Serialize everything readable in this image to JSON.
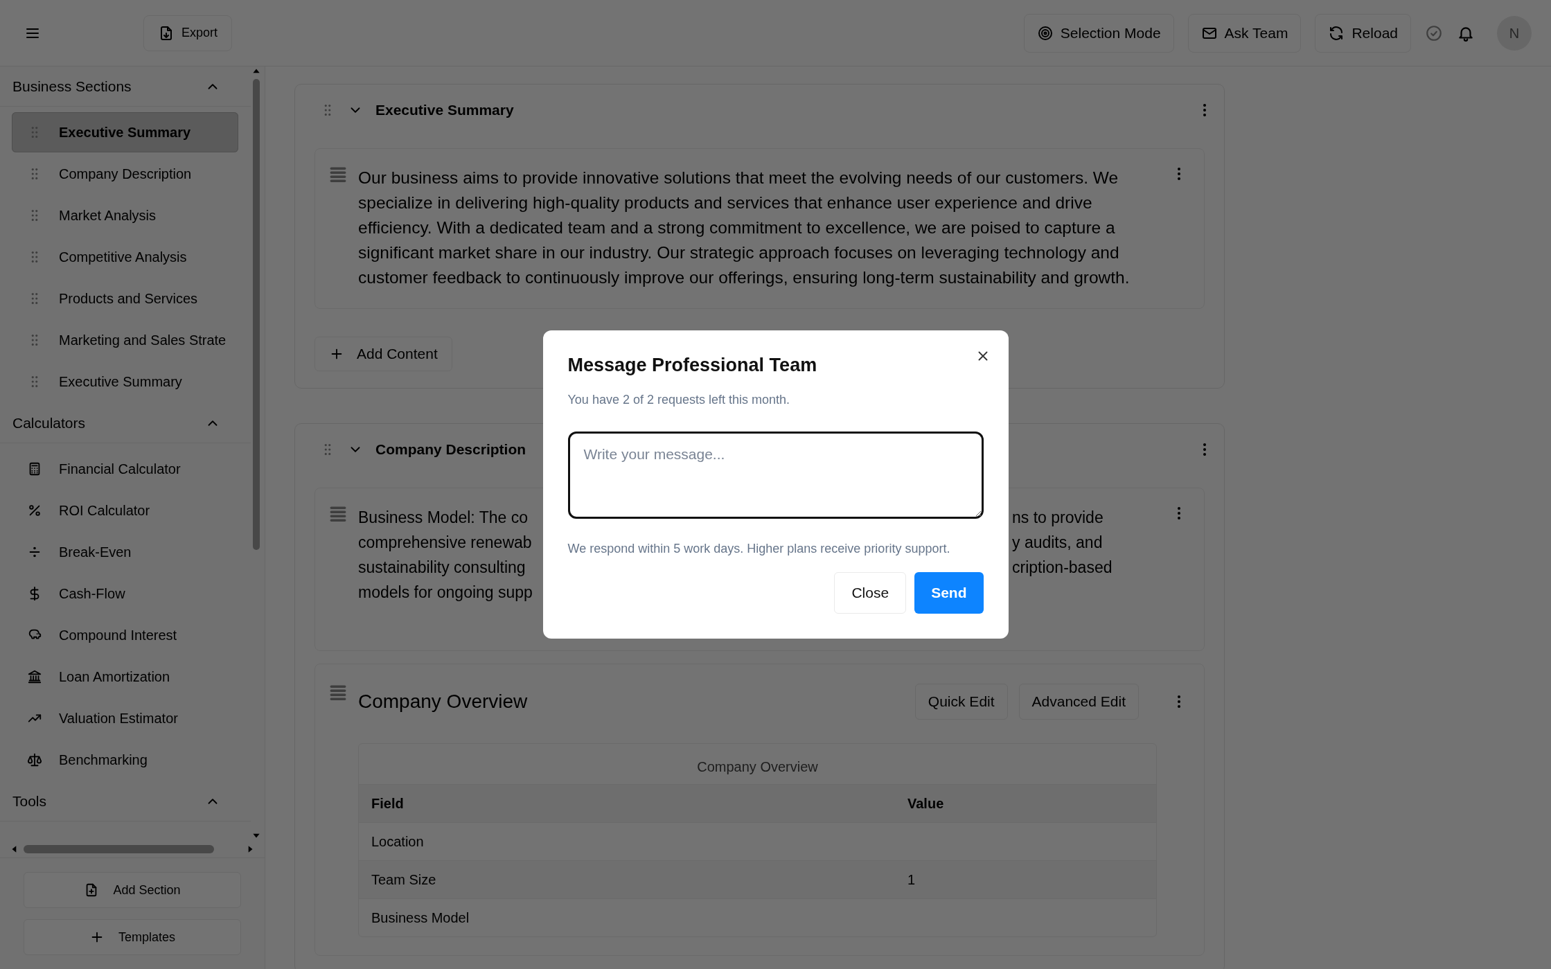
{
  "topbar": {
    "export_label": "Export",
    "actions": [
      {
        "label": "Selection Mode",
        "kind": "target"
      },
      {
        "label": "Ask Team",
        "kind": "mail"
      },
      {
        "label": "Reload",
        "kind": "reload"
      }
    ],
    "avatar_initial": "N"
  },
  "sidebar": {
    "groups": [
      {
        "title": "Business Sections",
        "expanded": true,
        "items": [
          {
            "label": "Executive Summary",
            "kind": "grip",
            "selected": true
          },
          {
            "label": "Company Description",
            "kind": "grip",
            "selected": false
          },
          {
            "label": "Market Analysis",
            "kind": "grip",
            "selected": false
          },
          {
            "label": "Competitive Analysis",
            "kind": "grip",
            "selected": false
          },
          {
            "label": "Products and Services",
            "kind": "grip",
            "selected": false
          },
          {
            "label": "Marketing and Sales Strate",
            "kind": "grip",
            "selected": false
          },
          {
            "label": "Executive Summary",
            "kind": "grip",
            "selected": false
          }
        ]
      },
      {
        "title": "Calculators",
        "expanded": true,
        "items": [
          {
            "label": "Financial Calculator",
            "kind": "calculator",
            "selected": false
          },
          {
            "label": "ROI Calculator",
            "kind": "percent",
            "selected": false
          },
          {
            "label": "Break-Even",
            "kind": "divide",
            "selected": false
          },
          {
            "label": "Cash-Flow",
            "kind": "dollar",
            "selected": false
          },
          {
            "label": "Compound Interest",
            "kind": "piggy",
            "selected": false
          },
          {
            "label": "Loan Amortization",
            "kind": "bank",
            "selected": false
          },
          {
            "label": "Valuation Estimator",
            "kind": "trending",
            "selected": false
          },
          {
            "label": "Benchmarking",
            "kind": "scale",
            "selected": false
          }
        ]
      },
      {
        "title": "Tools",
        "expanded": true
      }
    ],
    "buttons": [
      {
        "label": "Add Section",
        "kind": "fileplus"
      },
      {
        "label": "Templates",
        "kind": "plus"
      }
    ]
  },
  "sections": [
    {
      "title": "Executive Summary",
      "expanded": true,
      "blocks": [
        {
          "kind": "text",
          "text": "Our business aims to provide innovative solutions that meet the evolving needs of our customers. We specialize in delivering high-quality products and services that enhance user experience and drive efficiency. With a dedicated team and a strong commitment to excellence, we are poised to capture a significant market share in our industry. Our strategic approach focuses on leveraging technology and customer feedback to continuously improve our offerings, ensuring long-term sustainability and growth."
        }
      ],
      "add_content": "Add Content"
    },
    {
      "title": "Company Description",
      "expanded": true,
      "blocks": [
        {
          "kind": "covered_text",
          "lines": [
            {
              "left": "Business Model: The co",
              "right": "ns to provide"
            },
            {
              "left": "comprehensive renewab",
              "right": "y audits, and"
            },
            {
              "left": "sustainability consulting",
              "right": "cription-based"
            },
            {
              "left": "models for ongoing supp"
            }
          ]
        },
        {
          "kind": "table",
          "title": "Company Overview",
          "buttons": [
            "Quick Edit",
            "Advanced Edit"
          ],
          "caption": "Company Overview",
          "columns": [
            "Field",
            "Value"
          ],
          "rows": [
            {
              "field": "Location"
            },
            {
              "field": "Team Size",
              "value": "1"
            },
            {
              "field": "Business Model"
            }
          ]
        }
      ]
    }
  ],
  "modal": {
    "title": "Message Professional Team",
    "subtitle": "You have 2 of 2 requests left this month.",
    "placeholder": "Write your message...",
    "note": "We respond within 5 work days. Higher plans receive priority support.",
    "buttons": [
      {
        "label": "Close",
        "kind": "secondary"
      },
      {
        "label": "Send",
        "kind": "primary"
      }
    ]
  }
}
